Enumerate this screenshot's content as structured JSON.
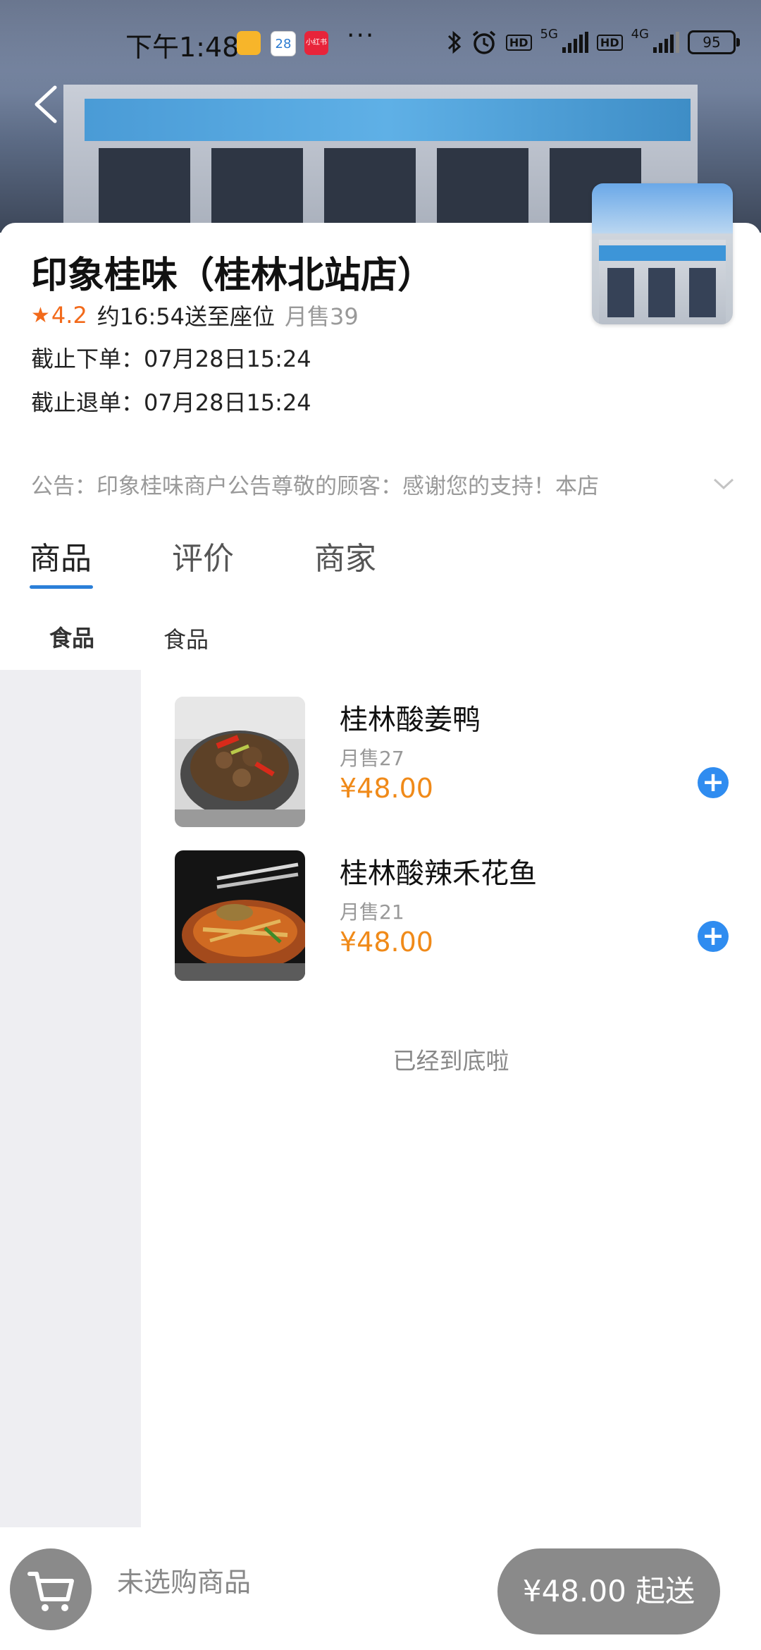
{
  "status_bar": {
    "time": "下午1:48",
    "calendar_day": "28",
    "app_badge": "小红书",
    "more": "···",
    "hd1": "HD",
    "net1": "5G",
    "hd2": "HD",
    "net2": "4G",
    "battery": "95"
  },
  "store": {
    "name": "印象桂味（桂林北站店）",
    "rating": "4.2",
    "eta": "约16:54送至座位",
    "monthly_sales": "月售39",
    "order_deadline": "截止下单：07月28日15:24",
    "refund_deadline": "截止退单：07月28日15:24",
    "notice": "公告：印象桂味商户公告尊敬的顾客：感谢您的支持！本店"
  },
  "tabs": [
    {
      "label": "商品",
      "active": true
    },
    {
      "label": "评价",
      "active": false
    },
    {
      "label": "商家",
      "active": false
    }
  ],
  "category": {
    "sidebar_label": "食品",
    "section_label": "食品"
  },
  "products": [
    {
      "name": "桂林酸姜鸭",
      "sales": "月售27",
      "price": "¥48.00"
    },
    {
      "name": "桂林酸辣禾花鱼",
      "sales": "月售21",
      "price": "¥48.00"
    }
  ],
  "end_text": "已经到底啦",
  "cart": {
    "empty_text": "未选购商品",
    "checkout_label": "¥48.00 起送"
  },
  "colors": {
    "accent_blue": "#2f8cf0",
    "price_orange": "#f08a19",
    "rating_orange": "#f26a1b",
    "disabled_gray": "#8a8a8a"
  }
}
